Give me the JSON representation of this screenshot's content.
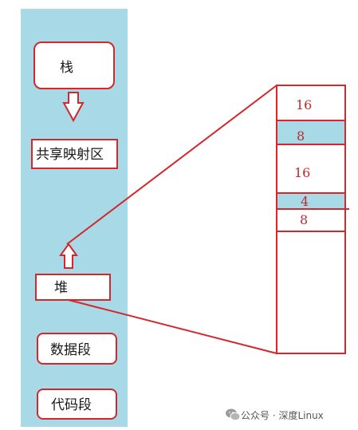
{
  "colors": {
    "panel": "#a7d9e6",
    "line": "#d4262b",
    "box_fill": "#ffffff",
    "heap_cell_highlight": "#a7d9e6"
  },
  "memory_segments": [
    {
      "id": "stack",
      "label": "栈"
    },
    {
      "id": "shared-mapping",
      "label": "共享映射区"
    },
    {
      "id": "heap",
      "label": "堆"
    },
    {
      "id": "data",
      "label": "数据段"
    },
    {
      "id": "code",
      "label": "代码段"
    }
  ],
  "heap_detail": {
    "cells": [
      {
        "value": "16",
        "highlight": false
      },
      {
        "value": "8",
        "highlight": true
      },
      {
        "value": "16",
        "highlight": false
      },
      {
        "value": "4",
        "highlight": true
      },
      {
        "value": "8",
        "highlight": false
      },
      {
        "value": "",
        "highlight": false
      }
    ]
  },
  "watermark": {
    "icon": "wechat-icon",
    "text": "公众号 · 深度Linux"
  }
}
